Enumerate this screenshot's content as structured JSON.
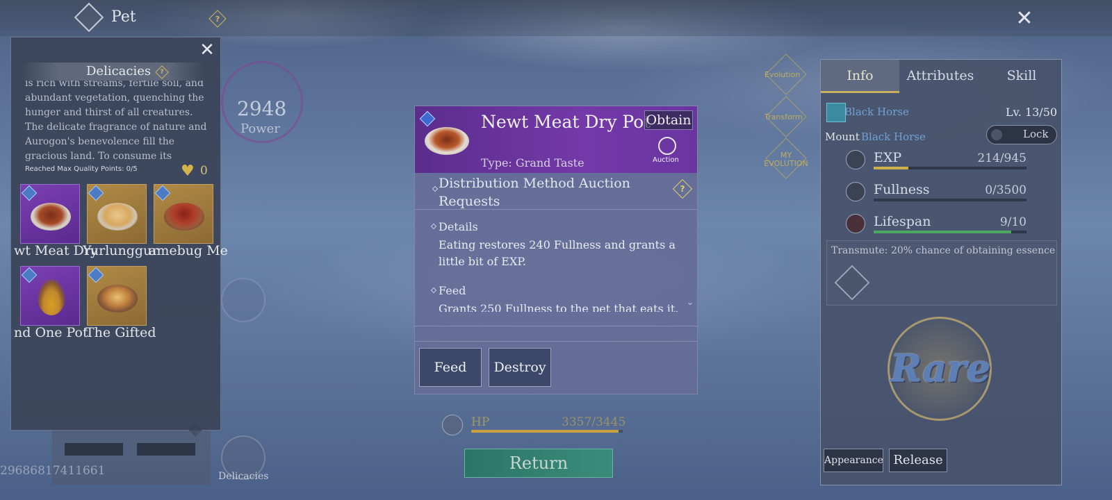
{
  "top": {
    "title": "Pet"
  },
  "left_panel": {
    "title": "Delicacies",
    "description_lines": [
      "is rich with streams, fertile soil, and",
      "abundant vegetation, quenching the",
      "hunger and thirst of all creatures.",
      "The delicate fragrance of nature and",
      "Aurogon's benevolence fill the",
      "gracious land. To consume its"
    ],
    "quality_points": "Reached Max Quality Points: 0/5",
    "heart_count": "0",
    "items": [
      {
        "name": "wt Meat Dry",
        "rarity": "purple",
        "food": "stew"
      },
      {
        "name": "Yurlunggur",
        "rarity": "gold",
        "food": "rice"
      },
      {
        "name": "amebug Me",
        "rarity": "gold",
        "food": "bowl"
      },
      {
        "name": "nd One Pot",
        "rarity": "purple",
        "food": "pot"
      },
      {
        "name": "The Gifted",
        "rarity": "gold",
        "food": "gift"
      }
    ],
    "pet_id": "29686817411661"
  },
  "power": {
    "value": "2948",
    "label": "Power"
  },
  "side_buttons": {
    "delicacies_label": "Delicacies"
  },
  "evolution": {
    "evolution": "Evolution",
    "transform": "Transform",
    "my_evolution": "MY EVOLUTION"
  },
  "tooltip": {
    "name": "Newt Meat Dry Pot",
    "obtain_label": "Obtain",
    "auction_label": "Auction",
    "type_line": "Type: Grand Taste",
    "distribution": "Distribution Method    Auction Requests",
    "details_title": "Details",
    "details_text": "Eating restores 240 Fullness and grants a little bit of EXP.",
    "feed_title": "Feed",
    "feed_text": "Grants 250 Fullness to the pet that eats it.",
    "feed_button": "Feed",
    "destroy_button": "Destroy"
  },
  "hp": {
    "label": "HP",
    "value": "3357/3445",
    "fraction": 0.974
  },
  "return_label": "Return",
  "right_panel": {
    "tabs": [
      "Info",
      "Attributes",
      "Skill"
    ],
    "active_tab": 0,
    "pet_name": "Black Horse",
    "level": "Lv. 13/50",
    "mount_label": "Mount",
    "mount_name": "Black Horse",
    "lock_label": "Lock",
    "stats": [
      {
        "label": "EXP",
        "value": "214/945",
        "fraction": 0.226,
        "color": "#c9b04a"
      },
      {
        "label": "Fullness",
        "value": "0/3500",
        "fraction": 0.0,
        "color": "#6ab0d0"
      },
      {
        "label": "Lifespan",
        "value": "9/10",
        "fraction": 0.9,
        "color": "#4aa860"
      }
    ],
    "transmute": "Transmute: 20% chance of obtaining essence",
    "rarity": "Rare",
    "appearance_button": "Appearance",
    "release_button": "Release"
  }
}
